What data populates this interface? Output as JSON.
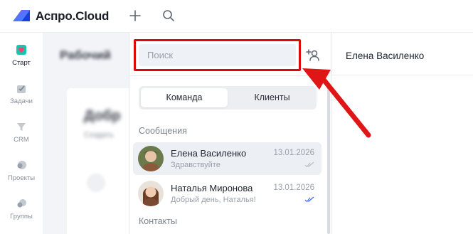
{
  "app": {
    "brand": "Аспро.Cloud"
  },
  "topbar": {
    "add_icon": "plus-icon",
    "search_icon": "search-icon"
  },
  "nav": {
    "items": [
      {
        "label": "Старт",
        "icon": "heart-icon",
        "active": true
      },
      {
        "label": "Задачи",
        "icon": "tasks-icon",
        "active": false
      },
      {
        "label": "CRM",
        "icon": "funnel-icon",
        "active": false
      },
      {
        "label": "Проекты",
        "icon": "projects-icon",
        "active": false
      },
      {
        "label": "Группы",
        "icon": "groups-icon",
        "active": false
      }
    ]
  },
  "workspace": {
    "title": "Рабочий",
    "card_title": "Добр",
    "card_sub": "Создать"
  },
  "chats": {
    "search_placeholder": "Поиск",
    "add_user_icon": "add-user-icon",
    "tabs": [
      "Команда",
      "Клиенты"
    ],
    "active_tab": "Команда",
    "messages_heading": "Сообщения",
    "contacts_heading": "Контакты",
    "items": [
      {
        "name": "Елена Василенко",
        "preview": "Здравствуйте",
        "date": "13.01.2026",
        "read": false,
        "selected": true
      },
      {
        "name": "Наталья Миронова",
        "preview": "Добрый день, Наталья!",
        "date": "13.01.2026",
        "read": true,
        "selected": false
      }
    ]
  },
  "conversation": {
    "title": "Елена Василенко"
  },
  "colors": {
    "accent": "#3d6bff",
    "highlight": "#d90b0b",
    "selected_row": "#eceff4"
  }
}
